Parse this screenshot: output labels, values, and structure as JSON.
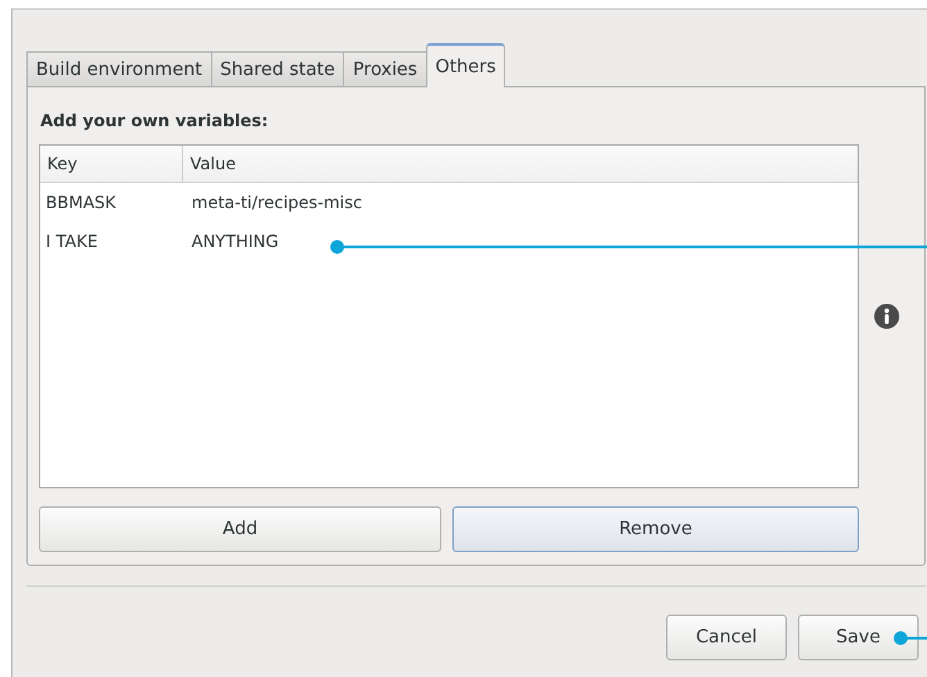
{
  "tabs": [
    {
      "label": "Build environment",
      "selected": false
    },
    {
      "label": "Shared state",
      "selected": false
    },
    {
      "label": "Proxies",
      "selected": false
    },
    {
      "label": "Others",
      "selected": true
    }
  ],
  "section_label": "Add your own variables:",
  "table": {
    "columns": [
      "Key",
      "Value"
    ],
    "rows": [
      {
        "key": "BBMASK",
        "value": "meta-ti/recipes-misc"
      },
      {
        "key": "I TAKE",
        "value": "ANYTHING"
      }
    ]
  },
  "table_buttons": [
    {
      "label": "Add",
      "focused": false
    },
    {
      "label": "Remove",
      "focused": true
    }
  ],
  "dialog_buttons": [
    {
      "label": "Cancel"
    },
    {
      "label": "Save"
    }
  ]
}
